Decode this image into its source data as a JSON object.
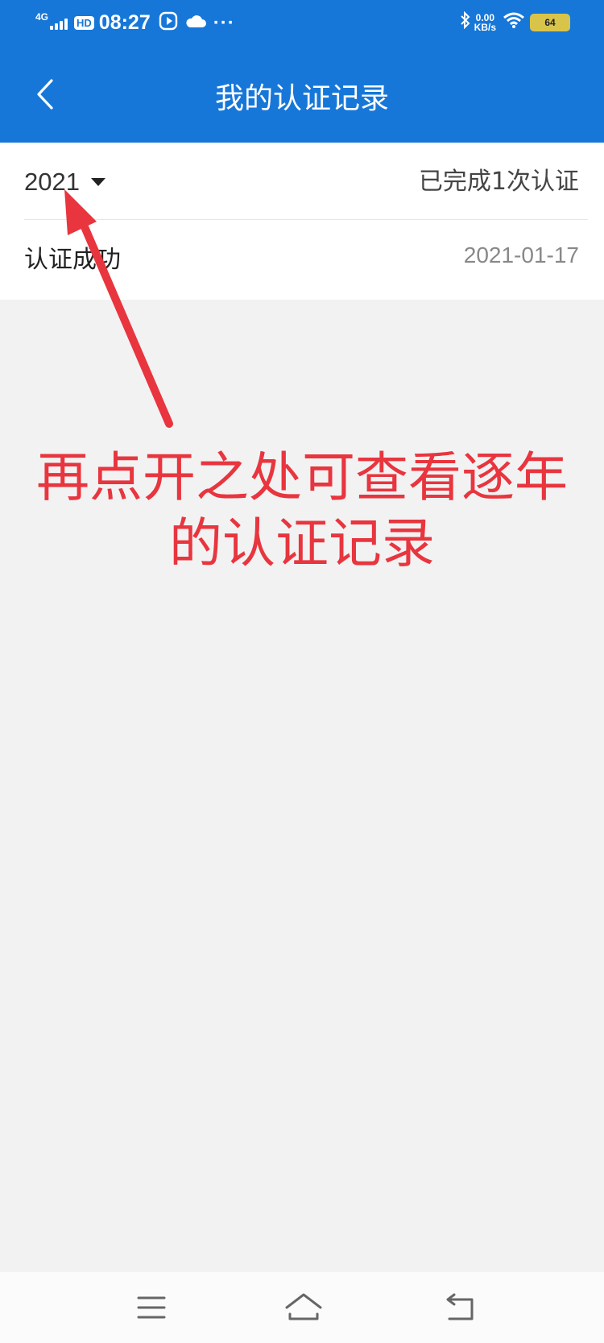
{
  "status_bar": {
    "network": "4G",
    "hd": "HD",
    "time": "08:27",
    "more": "···",
    "speed_value": "0.00",
    "speed_unit": "KB/s",
    "battery": "64"
  },
  "header": {
    "title": "我的认证记录"
  },
  "filter": {
    "year": "2021",
    "summary": "已完成1次认证"
  },
  "records": [
    {
      "status": "认证成功",
      "date": "2021-01-17"
    }
  ],
  "annotation": {
    "line1": "再点开之处可查看逐年",
    "line2": "的认证记录",
    "color": "#e8353e"
  },
  "colors": {
    "header_bg": "#1677d9",
    "page_bg": "#f2f2f3"
  },
  "icons": {
    "back": "back-arrow-icon",
    "caret": "caret-down-icon",
    "menu": "menu-icon",
    "home": "home-icon",
    "return": "return-icon"
  }
}
